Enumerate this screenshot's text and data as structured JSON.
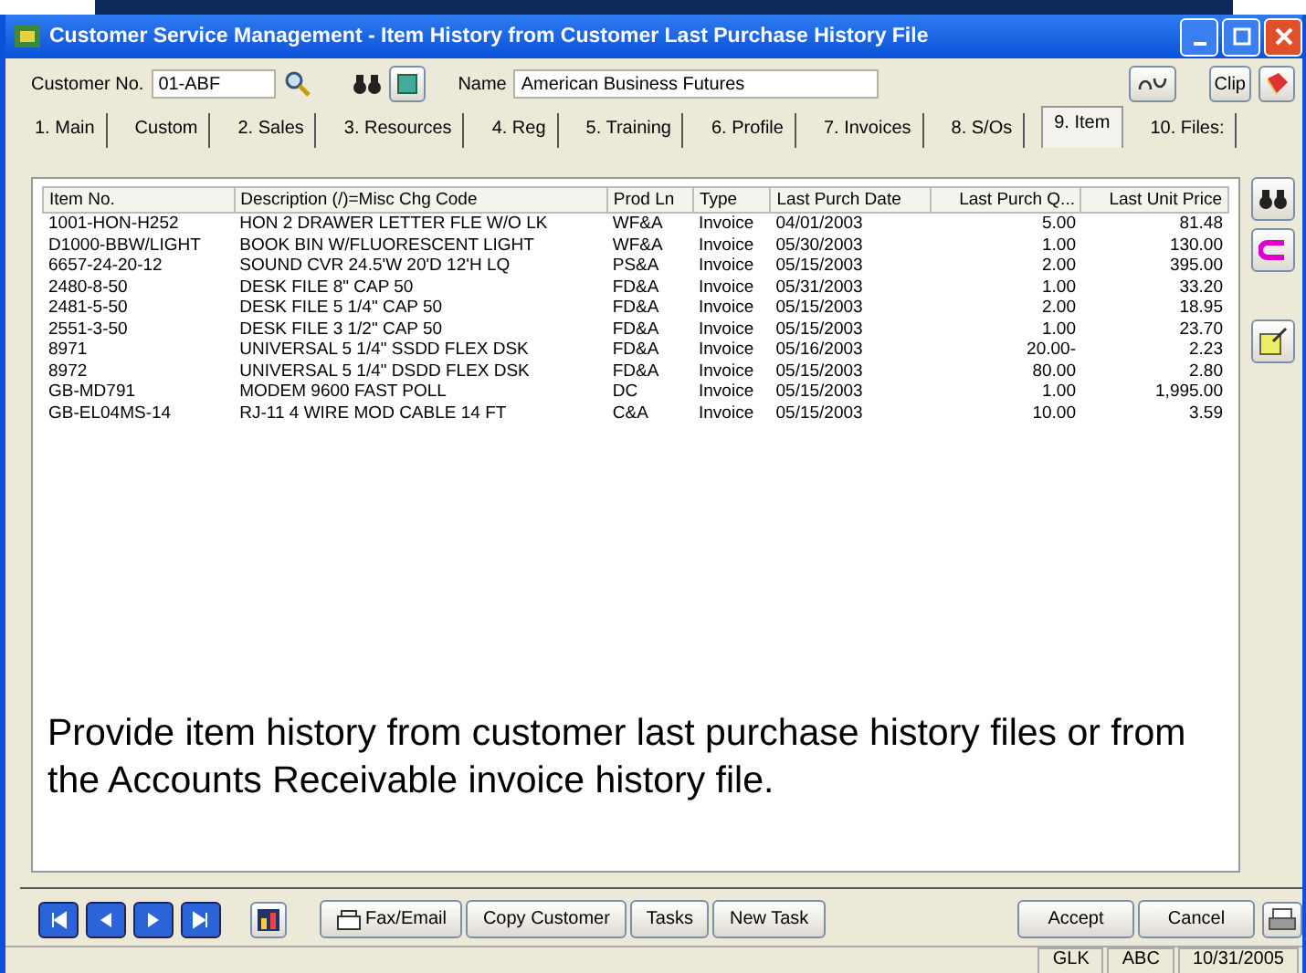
{
  "window": {
    "title": "Customer Service Management - Item History from Customer Last Purchase History File"
  },
  "header": {
    "customer_label": "Customer No.",
    "customer_value": "01-ABF",
    "name_label": "Name",
    "name_value": "American Business Futures",
    "buttons": [
      "Clip"
    ]
  },
  "tabs": [
    {
      "label": "1. Main",
      "selected": false
    },
    {
      "label": "Custom",
      "selected": false
    },
    {
      "label": "2. Sales",
      "selected": false
    },
    {
      "label": "3. Resources",
      "selected": false
    },
    {
      "label": "4. Reg",
      "selected": false
    },
    {
      "label": "5. Training",
      "selected": false
    },
    {
      "label": "6. Profile",
      "selected": false
    },
    {
      "label": "7. Invoices",
      "selected": false
    },
    {
      "label": "8. S/Os",
      "selected": false
    },
    {
      "label": "9. Item",
      "selected": true
    },
    {
      "label": "10. Files:",
      "selected": false
    }
  ],
  "table": {
    "columns": [
      "Item No.",
      "Description (/)=Misc Chg Code",
      "Prod Ln",
      "Type",
      "Last Purch Date",
      "Last Purch Q...",
      "Last Unit Price"
    ],
    "rows": [
      [
        "1001-HON-H252",
        "HON 2 DRAWER LETTER FLE W/O LK",
        "WF&A",
        "Invoice",
        "04/01/2003",
        "5.00",
        "81.48"
      ],
      [
        "D1000-BBW/LIGHT",
        "BOOK BIN W/FLUORESCENT LIGHT",
        "WF&A",
        "Invoice",
        "05/30/2003",
        "1.00",
        "130.00"
      ],
      [
        "6657-24-20-12",
        "SOUND CVR 24.5'W 20'D 12'H LQ",
        "PS&A",
        "Invoice",
        "05/15/2003",
        "2.00",
        "395.00"
      ],
      [
        "2480-8-50",
        "DESK FILE 8\" CAP 50",
        "FD&A",
        "Invoice",
        "05/31/2003",
        "1.00",
        "33.20"
      ],
      [
        "2481-5-50",
        "DESK FILE 5 1/4\" CAP 50",
        "FD&A",
        "Invoice",
        "05/15/2003",
        "2.00",
        "18.95"
      ],
      [
        "2551-3-50",
        "DESK FILE 3 1/2\" CAP 50",
        "FD&A",
        "Invoice",
        "05/15/2003",
        "1.00",
        "23.70"
      ],
      [
        "8971",
        "UNIVERSAL 5 1/4\" SSDD FLEX DSK",
        "FD&A",
        "Invoice",
        "05/16/2003",
        "20.00-",
        "2.23"
      ],
      [
        "8972",
        "UNIVERSAL 5 1/4\" DSDD FLEX DSK",
        "FD&A",
        "Invoice",
        "05/15/2003",
        "80.00",
        "2.80"
      ],
      [
        "GB-MD791",
        "MODEM 9600 FAST POLL",
        "DC",
        "Invoice",
        "05/15/2003",
        "1.00",
        "1,995.00"
      ],
      [
        "GB-EL04MS-14",
        "RJ-11 4 WIRE MOD CABLE 14 FT",
        "C&A",
        "Invoice",
        "05/15/2003",
        "10.00",
        "3.59"
      ]
    ]
  },
  "caption": "Provide item history from customer last purchase history files or from the Accounts Receivable invoice history file.",
  "footer": {
    "left_buttons": [
      "Fax/Email",
      "Copy Customer",
      "Tasks",
      "New Task"
    ],
    "right_buttons": [
      "Accept",
      "Cancel"
    ]
  },
  "status_bar": [
    "GLK",
    "ABC",
    "10/31/2005"
  ]
}
